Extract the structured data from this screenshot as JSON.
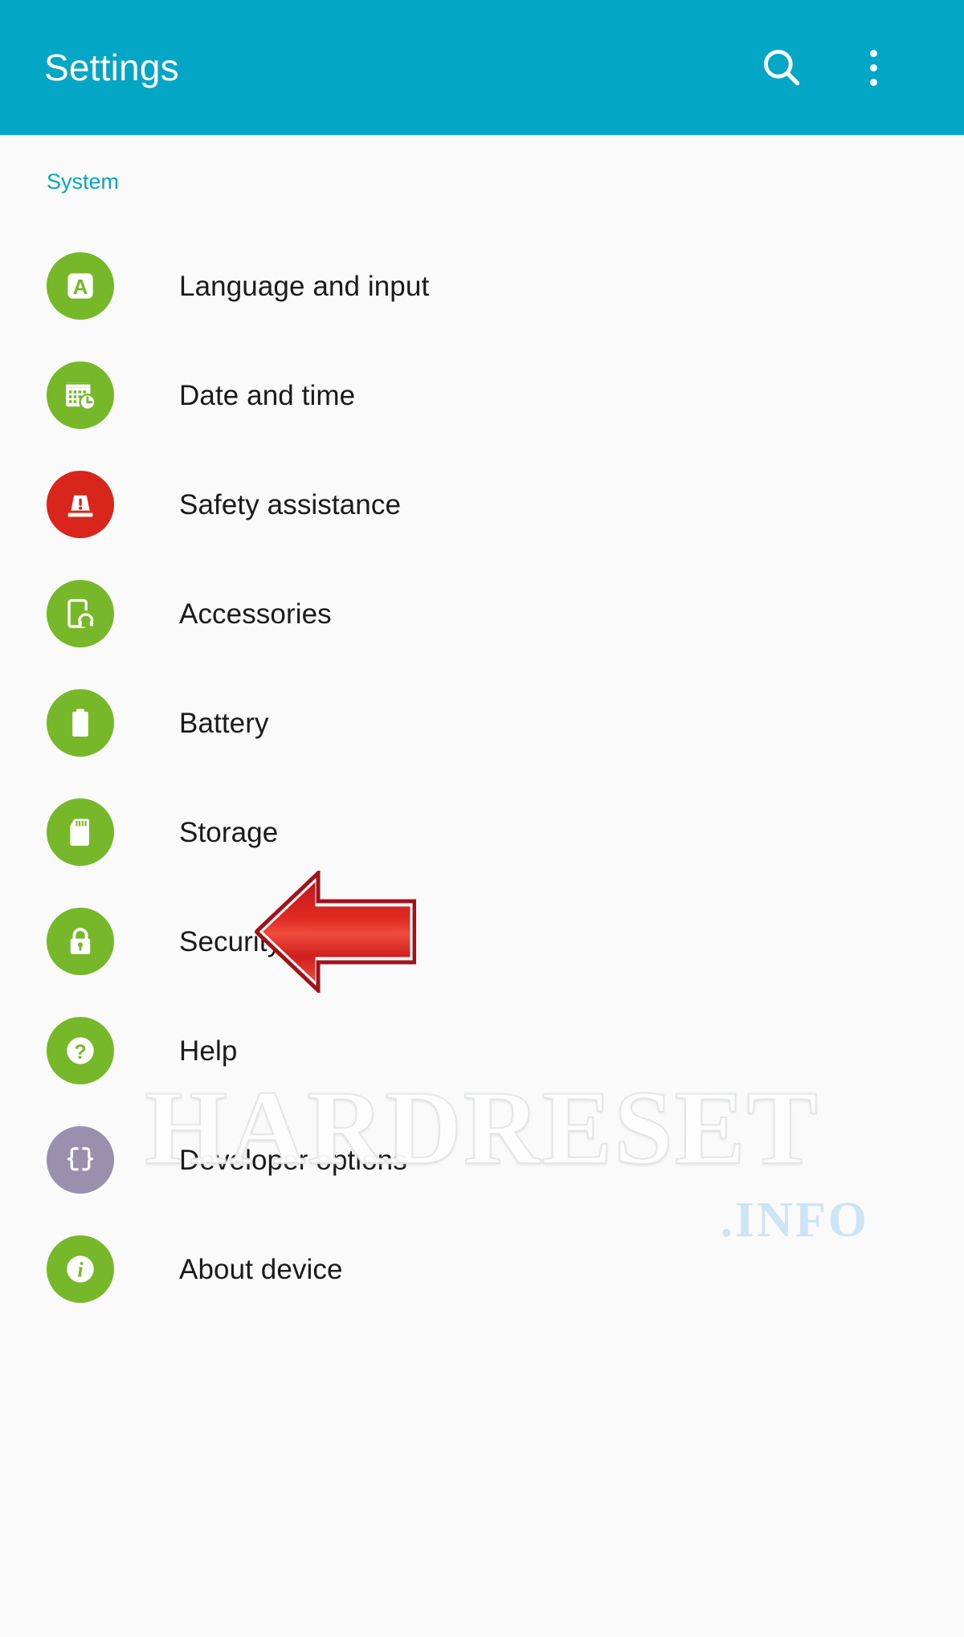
{
  "appbar": {
    "title": "Settings",
    "search_icon": "search-icon",
    "overflow_icon": "overflow-menu-icon",
    "background_color": "#03a6c4"
  },
  "section": {
    "title": "System",
    "color": "#03a6c4"
  },
  "colors": {
    "icon_green": "#76b82a",
    "icon_red": "#d8261c",
    "icon_purple": "#9890ad",
    "annotation_red": "#d3222a",
    "label_text": "#1a1a1a",
    "page_background": "#fafafa"
  },
  "list": {
    "items": [
      {
        "label": "Language and input",
        "icon": "language-input-icon",
        "icon_color": "#76b82a"
      },
      {
        "label": "Date and time",
        "icon": "calendar-clock-icon",
        "icon_color": "#76b82a"
      },
      {
        "label": "Safety assistance",
        "icon": "emergency-siren-icon",
        "icon_color": "#d8261c"
      },
      {
        "label": "Accessories",
        "icon": "headset-device-icon",
        "icon_color": "#76b82a"
      },
      {
        "label": "Battery",
        "icon": "battery-icon",
        "icon_color": "#76b82a"
      },
      {
        "label": "Storage",
        "icon": "sd-card-icon",
        "icon_color": "#76b82a"
      },
      {
        "label": "Security",
        "icon": "lock-icon",
        "icon_color": "#76b82a"
      },
      {
        "label": "Help",
        "icon": "question-mark-icon",
        "icon_color": "#76b82a"
      },
      {
        "label": "Developer options",
        "icon": "curly-braces-icon",
        "icon_color": "#9890ad"
      },
      {
        "label": "About device",
        "icon": "info-icon",
        "icon_color": "#76b82a"
      }
    ]
  },
  "annotation": {
    "type": "left-pointing-arrow",
    "target": "Storage",
    "color": "#d3222a"
  },
  "watermark": {
    "main": "HARDRESET",
    "sub": ".INFO"
  }
}
